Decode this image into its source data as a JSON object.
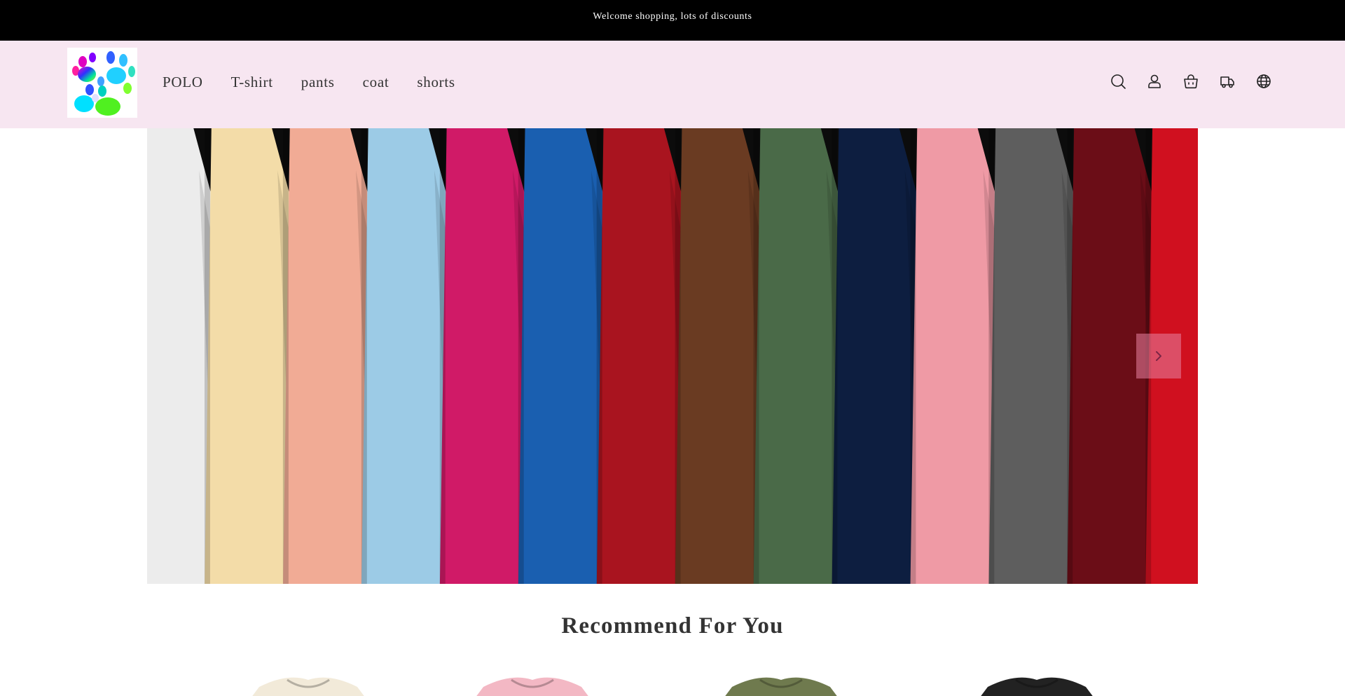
{
  "announcement": {
    "text": "Welcome shopping, lots of discounts"
  },
  "header": {
    "logo_icon": "paw-print-logo-icon",
    "nav": [
      {
        "label": "POLO"
      },
      {
        "label": "T-shirt"
      },
      {
        "label": "pants"
      },
      {
        "label": "coat"
      },
      {
        "label": "shorts"
      }
    ],
    "icons": [
      "search-icon",
      "account-icon",
      "cart-icon",
      "delivery-truck-icon",
      "globe-icon"
    ]
  },
  "hero": {
    "image_icon": "colorful-tshirts-on-rack",
    "shirt_colors": [
      "#ececec",
      "#f3dca8",
      "#f1ab95",
      "#9ccbe6",
      "#d01a67",
      "#1a5fb0",
      "#a9141f",
      "#6a3b22",
      "#4a6a48",
      "#0d1e40",
      "#ef9aa5",
      "#5e5e5e",
      "#6b0d17",
      "#d0101f"
    ],
    "next_icon": "chevron-right-icon"
  },
  "recommend": {
    "title": "Recommend For You",
    "product_colors": [
      "#f2ead9",
      "#f3b8c4",
      "#6f7a4e",
      "#222222"
    ]
  },
  "colors": {
    "announcement_bg": "#000000",
    "header_bg": "#f7e6f1",
    "next_button_bg": "#e882a0"
  }
}
